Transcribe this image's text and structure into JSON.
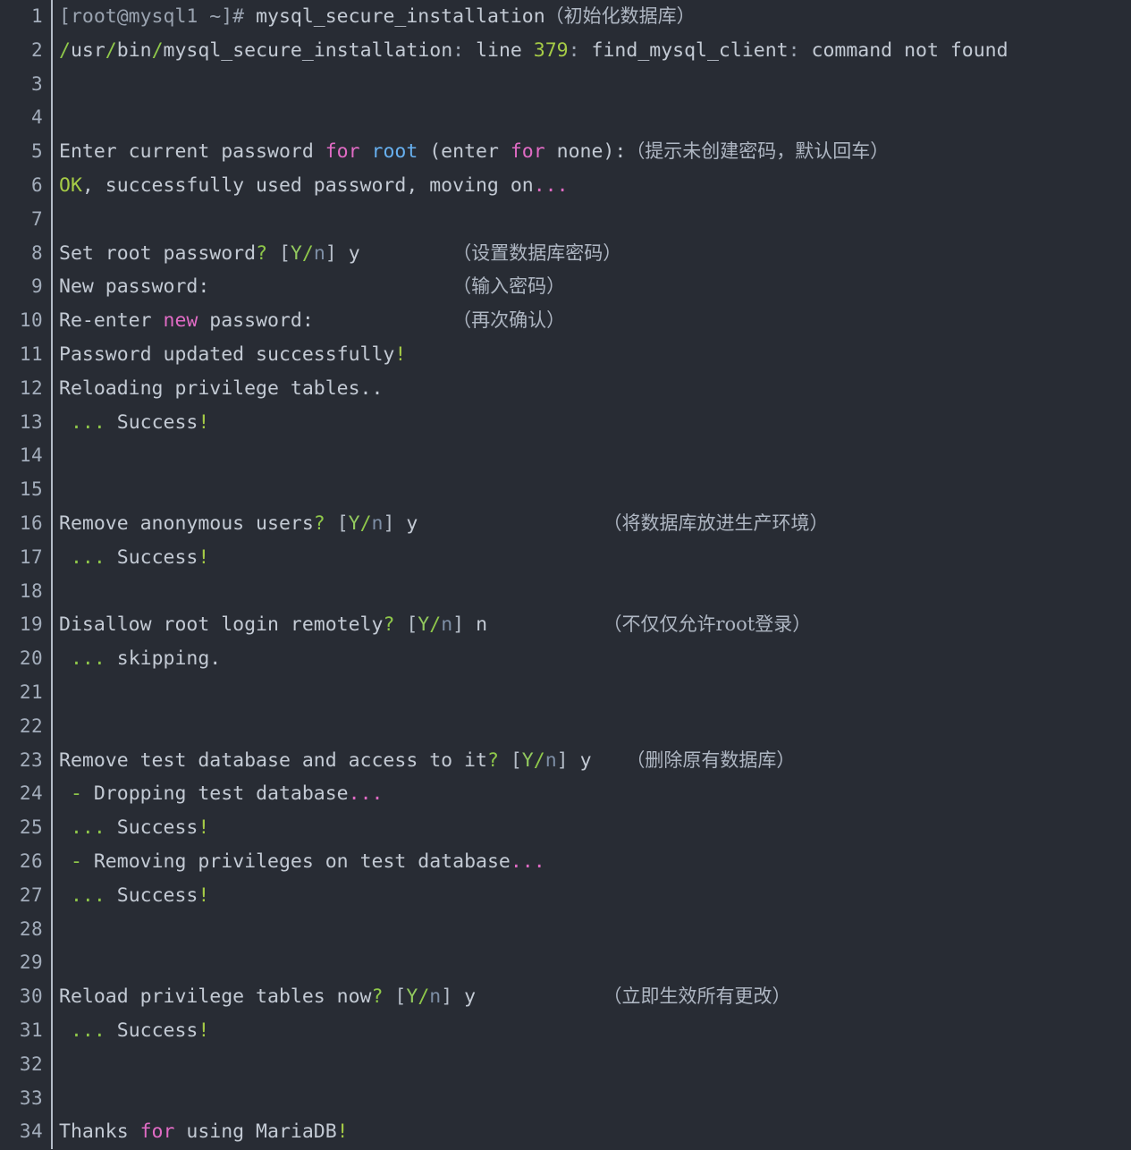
{
  "terminal": {
    "background": "#282c34",
    "gutter_color": "#a3adbb",
    "default_text_color": "#c3cad4",
    "accent_green": "#8fc84a",
    "accent_pink": "#e06bc4",
    "accent_blue": "#67b0ef",
    "annotation_color": "#aeb6c2",
    "total_lines": 34,
    "line_numbers": [
      "1",
      "2",
      "3",
      "4",
      "5",
      "6",
      "7",
      "8",
      "9",
      "10",
      "11",
      "12",
      "13",
      "14",
      "15",
      "16",
      "17",
      "18",
      "19",
      "20",
      "21",
      "22",
      "23",
      "24",
      "25",
      "26",
      "27",
      "28",
      "29",
      "30",
      "31",
      "32",
      "33",
      "34"
    ],
    "lines": [
      {
        "n": "1",
        "text": "[root@mysql1 ~]# mysql_secure_installation（初始化数据库）"
      },
      {
        "n": "2",
        "text": "/usr/bin/mysql_secure_installation: line 379: find_mysql_client: command not found"
      },
      {
        "n": "3",
        "text": ""
      },
      {
        "n": "4",
        "text": ""
      },
      {
        "n": "5",
        "text": "Enter current password for root (enter for none): （提示未创建密码，默认回车）"
      },
      {
        "n": "6",
        "text": "OK, successfully used password, moving on..."
      },
      {
        "n": "7",
        "text": ""
      },
      {
        "n": "8",
        "text": "Set root password? [Y/n] y        （设置数据库密码）"
      },
      {
        "n": "9",
        "text": "New password:                     （输入密码）"
      },
      {
        "n": "10",
        "text": "Re-enter new password:            （再次确认）"
      },
      {
        "n": "11",
        "text": "Password updated successfully!"
      },
      {
        "n": "12",
        "text": "Reloading privilege tables.."
      },
      {
        "n": "13",
        "text": " ... Success!"
      },
      {
        "n": "14",
        "text": ""
      },
      {
        "n": "15",
        "text": ""
      },
      {
        "n": "16",
        "text": "Remove anonymous users? [Y/n] y                （将数据库放进生产环境）"
      },
      {
        "n": "17",
        "text": " ... Success!"
      },
      {
        "n": "18",
        "text": ""
      },
      {
        "n": "19",
        "text": "Disallow root login remotely? [Y/n] n          （不仅仅允许root登录）"
      },
      {
        "n": "20",
        "text": " ... skipping."
      },
      {
        "n": "21",
        "text": ""
      },
      {
        "n": "22",
        "text": ""
      },
      {
        "n": "23",
        "text": "Remove test database and access to it? [Y/n] y   （删除原有数据库）"
      },
      {
        "n": "24",
        "text": " - Dropping test database..."
      },
      {
        "n": "25",
        "text": " ... Success!"
      },
      {
        "n": "26",
        "text": " - Removing privileges on test database..."
      },
      {
        "n": "27",
        "text": " ... Success!"
      },
      {
        "n": "28",
        "text": ""
      },
      {
        "n": "29",
        "text": ""
      },
      {
        "n": "30",
        "text": "Reload privilege tables now? [Y/n] y            （立即生效所有更改）"
      },
      {
        "n": "31",
        "text": " ... Success!"
      },
      {
        "n": "32",
        "text": ""
      },
      {
        "n": "33",
        "text": ""
      },
      {
        "n": "34",
        "text": "Thanks for using MariaDB!"
      }
    ],
    "annotations": [
      {
        "line": "1",
        "text": "（初始化数据库）"
      },
      {
        "line": "5",
        "text": "（提示未创建密码，默认回车）"
      },
      {
        "line": "8",
        "text": "（设置数据库密码）"
      },
      {
        "line": "9",
        "text": "（输入密码）"
      },
      {
        "line": "10",
        "text": "（再次确认）"
      },
      {
        "line": "16",
        "text": "（将数据库放进生产环境）"
      },
      {
        "line": "19",
        "text": "（不仅仅允许root登录）"
      },
      {
        "line": "23",
        "text": "（删除原有数据库）"
      },
      {
        "line": "30",
        "text": "（立即生效所有更改）"
      }
    ],
    "tokens": {
      "prompt": "[root@mysql1 ~]#",
      "command": "mysql_secure_installation",
      "script_path": "/usr/bin/mysql_secure_installation",
      "error_line_label": "line",
      "error_line_number": "379",
      "error_function": "find_mysql_client",
      "error_message": "command not found",
      "prompt_enter_password": "Enter current password for root (enter for none):",
      "ok_word": "OK",
      "ok_rest": ", successfully used password, moving on...",
      "set_root_password": "Set root password?",
      "yn": "[Y/n]",
      "answer_y": "y",
      "answer_n": "n",
      "new_password": "New password:",
      "reenter_password": "Re-enter new password:",
      "password_updated": "Password updated successfully!",
      "reloading_tables": "Reloading privilege tables..",
      "success": "... Success!",
      "remove_anonymous": "Remove anonymous users?",
      "disallow_remote": "Disallow root login remotely?",
      "skipping": "... skipping.",
      "remove_test_db": "Remove test database and access to it?",
      "dropping_test_db": "- Dropping test database...",
      "removing_privileges": "- Removing privileges on test database...",
      "reload_now": "Reload privilege tables now?",
      "thanks": "Thanks for using MariaDB!"
    }
  }
}
